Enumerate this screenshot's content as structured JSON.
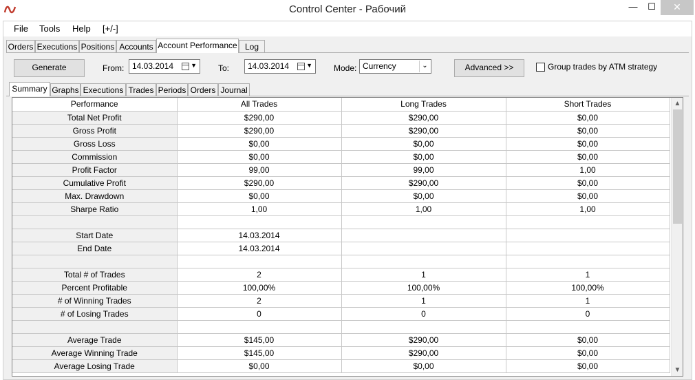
{
  "window": {
    "title": "Control Center - Рабочий",
    "min_glyph": "—",
    "max_glyph": "☐",
    "close_glyph": "✕"
  },
  "menu": [
    "File",
    "Tools",
    "Help",
    "[+/-]"
  ],
  "main_tabs": [
    "Orders",
    "Executions",
    "Positions",
    "Accounts",
    "Account Performance",
    "Log"
  ],
  "main_tabs_active": "Account Performance",
  "toolbar": {
    "generate_label": "Generate",
    "from_label": "From:",
    "from_value": "14.03.2014",
    "to_label": "To:",
    "to_value": "14.03.2014",
    "mode_label": "Mode:",
    "mode_value": "Currency",
    "advanced_label": "Advanced >>",
    "group_label": "Group trades by ATM strategy",
    "group_checked": false
  },
  "sub_tabs": [
    "Summary",
    "Graphs",
    "Executions",
    "Trades",
    "Periods",
    "Orders",
    "Journal"
  ],
  "sub_tabs_active": "Summary",
  "table": {
    "columns": [
      "Performance",
      "All Trades",
      "Long Trades",
      "Short Trades"
    ],
    "rows": [
      [
        "Total Net Profit",
        "$290,00",
        "$290,00",
        "$0,00"
      ],
      [
        "Gross Profit",
        "$290,00",
        "$290,00",
        "$0,00"
      ],
      [
        "Gross Loss",
        "$0,00",
        "$0,00",
        "$0,00"
      ],
      [
        "Commission",
        "$0,00",
        "$0,00",
        "$0,00"
      ],
      [
        "Profit Factor",
        "99,00",
        "99,00",
        "1,00"
      ],
      [
        "Cumulative Profit",
        "$290,00",
        "$290,00",
        "$0,00"
      ],
      [
        "Max. Drawdown",
        "$0,00",
        "$0,00",
        "$0,00"
      ],
      [
        "Sharpe Ratio",
        "1,00",
        "1,00",
        "1,00"
      ],
      [
        "",
        "",
        "",
        ""
      ],
      [
        "Start Date",
        "14.03.2014",
        "",
        ""
      ],
      [
        "End Date",
        "14.03.2014",
        "",
        ""
      ],
      [
        "",
        "",
        "",
        ""
      ],
      [
        "Total # of Trades",
        "2",
        "1",
        "1"
      ],
      [
        "Percent Profitable",
        "100,00%",
        "100,00%",
        "100,00%"
      ],
      [
        "# of Winning Trades",
        "2",
        "1",
        "1"
      ],
      [
        "# of Losing Trades",
        "0",
        "0",
        "0"
      ],
      [
        "",
        "",
        "",
        ""
      ],
      [
        "Average Trade",
        "$145,00",
        "$290,00",
        "$0,00"
      ],
      [
        "Average Winning Trade",
        "$145,00",
        "$290,00",
        "$0,00"
      ],
      [
        "Average Losing Trade",
        "$0,00",
        "$0,00",
        "$0,00"
      ]
    ]
  },
  "colors": {
    "window_bg": "#f0f0f0",
    "close_button": "#c7c7c7",
    "app_icon_red": "#c0392b"
  }
}
